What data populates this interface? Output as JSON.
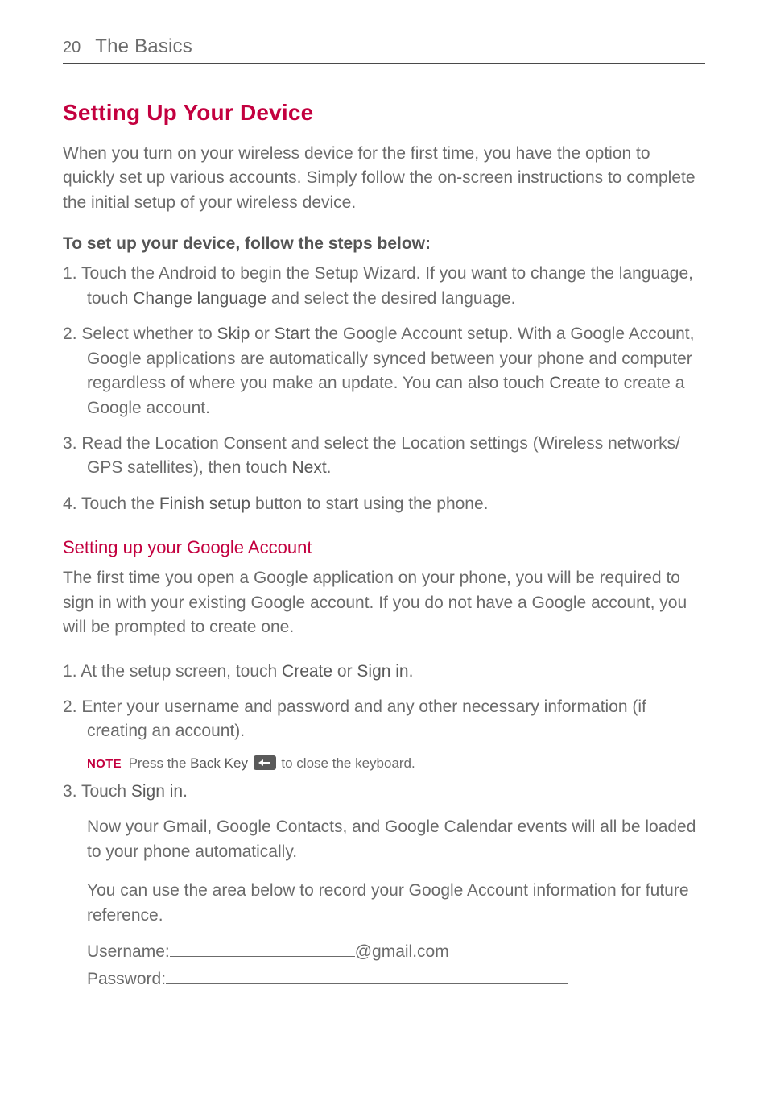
{
  "header": {
    "page_number": "20",
    "chapter": "The Basics"
  },
  "main_heading": "Setting Up Your Device",
  "intro": "When you turn on your wireless device for the first time, you have the option to quickly set up various accounts. Simply follow the on-screen instructions to complete the initial setup of your wireless device.",
  "setup_heading": "To set up your device, follow the steps below:",
  "step1_a": "Touch the Android to begin the Setup Wizard. If you want to change the language, touch ",
  "step1_bold": "Change language",
  "step1_b": " and select the desired language.",
  "step2_a": "Select whether to ",
  "step2_skip": "Skip",
  "step2_or": " or ",
  "step2_start": "Start",
  "step2_b": " the Google Account setup. With a Google Account, Google applications are automatically synced between your phone and computer regardless of where you make an update. You can also touch ",
  "step2_create": "Create",
  "step2_c": " to create a Google account.",
  "step3_a": "Read the Location Consent and select the Location settings (Wireless networks/ GPS satellites), then touch ",
  "step3_next": "Next",
  "step3_b": ".",
  "step4_a": "Touch the ",
  "step4_finish": "Finish setup",
  "step4_b": " button to start using the phone.",
  "google_heading": "Setting up your Google Account",
  "google_intro": "The first time you open a Google application on your phone, you will be required to sign in with your existing Google account. If you do not have a Google account, you will be prompted to create one.",
  "g_step1_a": "At the setup screen, touch ",
  "g_step1_create": "Create",
  "g_step1_or": " or ",
  "g_step1_signin": "Sign in",
  "g_step1_b": ".",
  "g_step2": "Enter your username and password and any other necessary information (if creating an account).",
  "note_label": "NOTE",
  "note_a": " Press the ",
  "note_backkey": "Back Key",
  "note_b": " to close the keyboard.",
  "g_step3_a": "Touch ",
  "g_step3_signin": "Sign in",
  "g_step3_b": ".",
  "after1": "Now your Gmail, Google Contacts, and Google Calendar events will all be loaded to your phone automatically.",
  "after2": "You can use the area below to record your Google Account information for future reference.",
  "username_label": "Username:",
  "username_suffix": "@gmail.com",
  "password_label": "Password:"
}
